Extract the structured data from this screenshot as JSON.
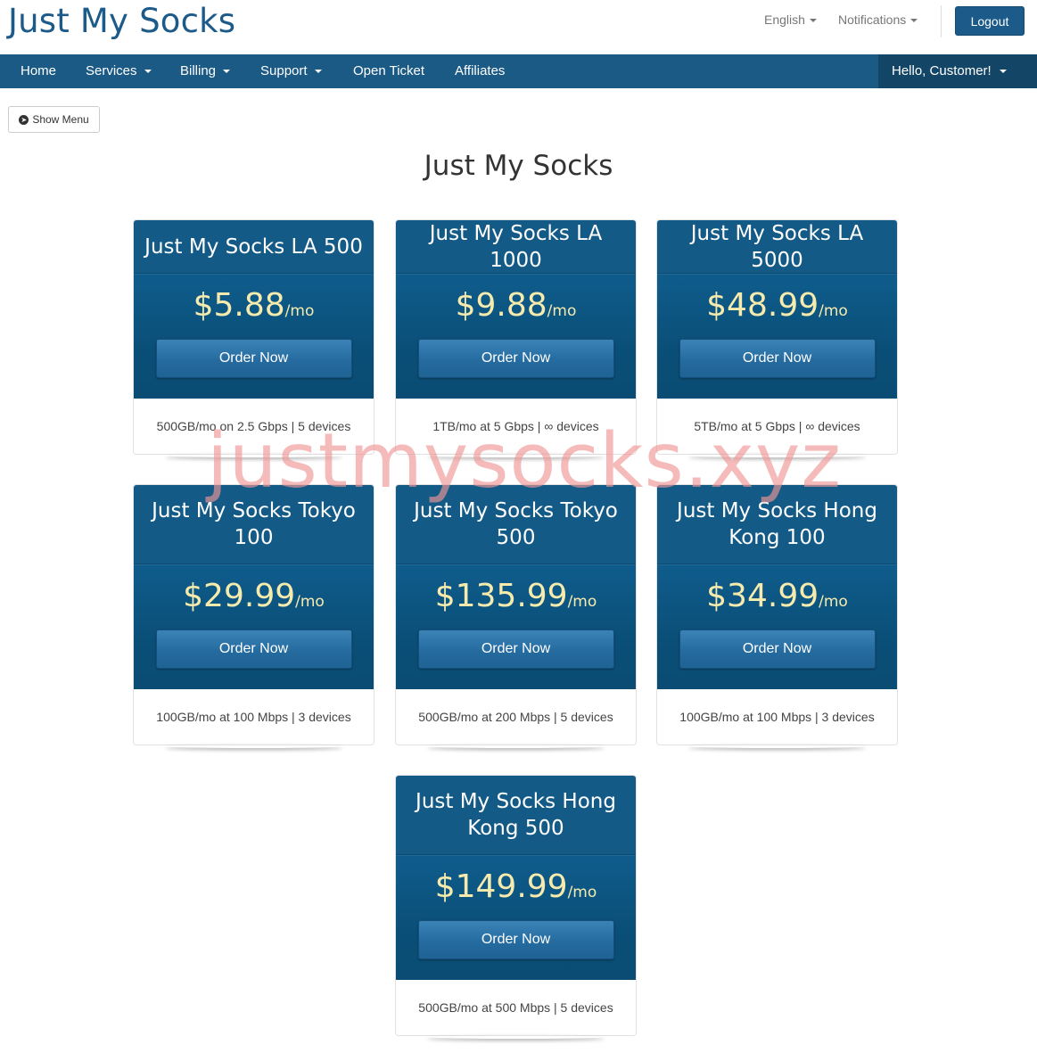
{
  "header": {
    "brand": "Just My Socks",
    "language": "English",
    "notifications": "Notifications",
    "logout": "Logout"
  },
  "nav": {
    "items": [
      "Home",
      "Services",
      "Billing",
      "Support",
      "Open Ticket",
      "Affiliates"
    ],
    "user": "Hello, Customer!"
  },
  "show_menu": "Show Menu",
  "page_title": "Just My Socks",
  "products": [
    {
      "name": "Just My Socks LA 500",
      "price": "$5.88",
      "period": "/mo",
      "button": "Order Now",
      "features": "500GB/mo on 2.5 Gbps | 5 devices"
    },
    {
      "name": "Just My Socks LA 1000",
      "price": "$9.88",
      "period": "/mo",
      "button": "Order Now",
      "features": "1TB/mo at 5 Gbps | ∞ devices"
    },
    {
      "name": "Just My Socks LA 5000",
      "price": "$48.99",
      "period": "/mo",
      "button": "Order Now",
      "features": "5TB/mo at 5 Gbps | ∞ devices"
    },
    {
      "name": "Just My Socks Tokyo 100",
      "price": "$29.99",
      "period": "/mo",
      "button": "Order Now",
      "features": "100GB/mo at 100 Mbps | 3 devices"
    },
    {
      "name": "Just My Socks Tokyo 500",
      "price": "$135.99",
      "period": "/mo",
      "button": "Order Now",
      "features": "500GB/mo at 200 Mbps | 5 devices"
    },
    {
      "name": "Just My Socks Hong Kong 100",
      "price": "$34.99",
      "period": "/mo",
      "button": "Order Now",
      "features": "100GB/mo at 100 Mbps | 3 devices"
    },
    {
      "name": "Just My Socks Hong Kong 500",
      "price": "$149.99",
      "period": "/mo",
      "button": "Order Now",
      "features": "500GB/mo at 500 Mbps | 5 devices"
    }
  ],
  "watermark": "justmysocks.xyz"
}
